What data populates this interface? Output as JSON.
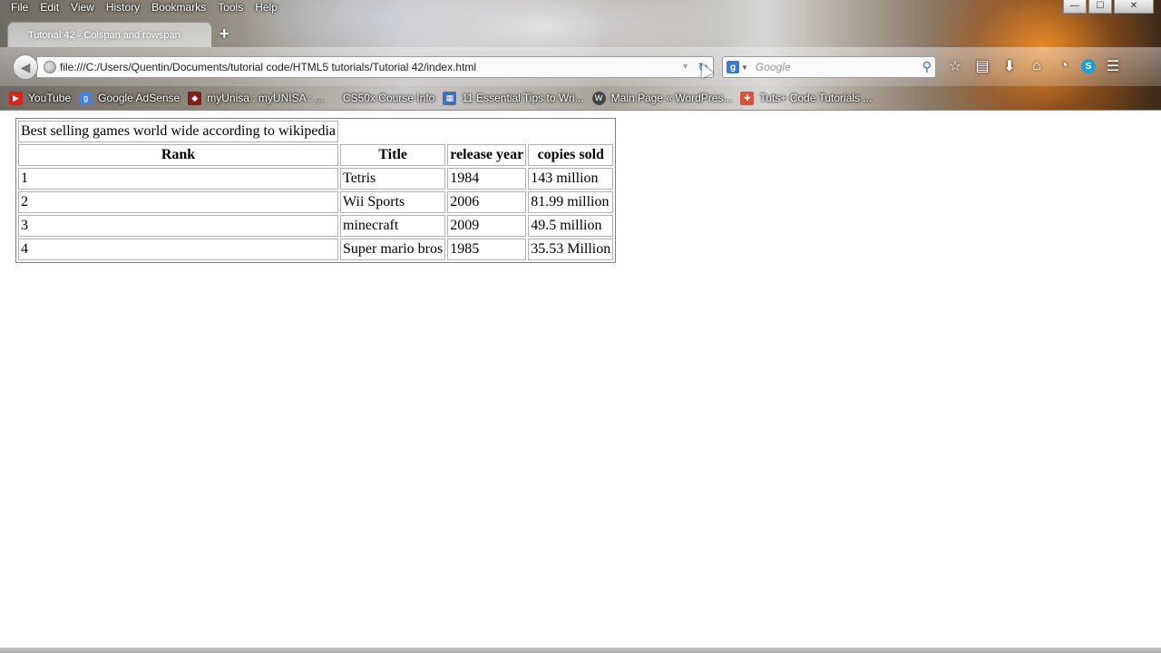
{
  "browser": {
    "menu": [
      "File",
      "Edit",
      "View",
      "History",
      "Bookmarks",
      "Tools",
      "Help"
    ],
    "window_controls": {
      "minimize": "—",
      "maximize": "☐",
      "close": "✕"
    },
    "tab": {
      "title": "Tutorial 42 - Colspan and rowspan",
      "new_tab": "+"
    },
    "url": "file:///C:/Users/Quentin/Documents/tutorial code/HTML5 tutorials/Tutorial 42/index.html",
    "search": {
      "engine_icon": "g",
      "placeholder": "Google"
    },
    "toolbar_icons": [
      "star-icon",
      "reading-list-icon",
      "download-icon",
      "home-icon",
      "circle-icon",
      "skype-icon",
      "menu-icon"
    ],
    "bookmarks": [
      {
        "label": "YouTube",
        "icon": "youtube-icon",
        "color": "#d9241a"
      },
      {
        "label": "Google AdSense",
        "icon": "google-icon",
        "color": "#4a7fd6"
      },
      {
        "label": "myUnisa : myUNISA : ...",
        "icon": "unisa-icon",
        "color": "#8a1a1a"
      },
      {
        "label": "CS50x Course Info",
        "icon": "",
        "color": ""
      },
      {
        "label": "11 Essential Tips to Wri...",
        "icon": "page-icon",
        "color": "#4a6fb0"
      },
      {
        "label": "Main Page « WordPres...",
        "icon": "wordpress-icon",
        "color": "#444444"
      },
      {
        "label": "Tuts+ Code Tutorials ...",
        "icon": "tuts-icon",
        "color": "#d9523a"
      }
    ]
  },
  "page": {
    "table": {
      "title": "Best selling games world wide according to wikipedia",
      "headers": [
        "Rank",
        "Title",
        "release year",
        "copies sold"
      ],
      "rows": [
        [
          "1",
          "Tetris",
          "1984",
          "143 million"
        ],
        [
          "2",
          "Wii Sports",
          "2006",
          "81.99 million"
        ],
        [
          "3",
          "minecraft",
          "2009",
          "49.5 million"
        ],
        [
          "4",
          "Super mario bros",
          "1985",
          "35.53 Million"
        ]
      ]
    }
  }
}
